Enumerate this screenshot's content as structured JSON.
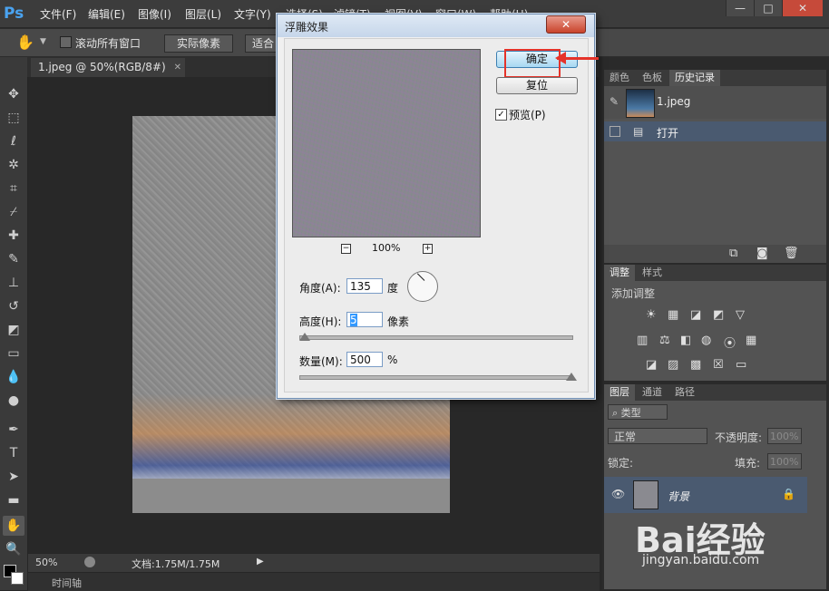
{
  "app": {
    "logo": "Ps"
  },
  "menu": [
    "文件(F)",
    "编辑(E)",
    "图像(I)",
    "图层(L)",
    "文字(Y)",
    "选择(S)",
    "滤镜(T)",
    "视图(V)",
    "窗口(W)",
    "帮助(H)"
  ],
  "window_controls": [
    "—",
    "□",
    "✕"
  ],
  "options_bar": {
    "scroll_all_label": "滚动所有窗口",
    "actual_pixels": "实际像素",
    "fit_screen": "适合"
  },
  "document_tab": {
    "label": "1.jpeg @ 50%(RGB/8#)",
    "close": "✕"
  },
  "status": {
    "zoom": "50%",
    "doc_info": "文档:1.75M/1.75M"
  },
  "timeline": {
    "label": "时间轴"
  },
  "history_panel": {
    "tabs": [
      "颜色",
      "色板",
      "历史记录"
    ],
    "snapshot_name": "1.jpeg",
    "items": [
      {
        "label": "打开"
      }
    ]
  },
  "adjustments_panel": {
    "tabs": [
      "调整",
      "样式"
    ],
    "title": "添加调整"
  },
  "layers_panel": {
    "tabs": [
      "图层",
      "通道",
      "路径"
    ],
    "filter_kind": "类型",
    "blend_mode": "正常",
    "opacity_label": "不透明度:",
    "opacity_value": "100%",
    "lock_label": "锁定:",
    "fill_label": "填充:",
    "fill_value": "100%",
    "layer_name": "背景"
  },
  "dialog": {
    "title": "浮雕效果",
    "close": "✕",
    "ok": "确定",
    "reset": "复位",
    "preview_label": "预览(P)",
    "preview_checked": true,
    "zoom": "100%",
    "angle_label": "角度(A):",
    "angle_value": "135",
    "angle_unit": "度",
    "height_label": "高度(H):",
    "height_value": "5",
    "height_unit": "像素",
    "amount_label": "数量(M):",
    "amount_value": "500",
    "amount_unit": "%",
    "height_slider_fraction": 0.02,
    "amount_slider_fraction": 1.0
  },
  "watermark": {
    "logo_text": "Bai经验",
    "url": "jingyan.baidu.com"
  },
  "colors": {
    "highlight": "#e5332a",
    "panel_selected": "#4a5a70"
  }
}
